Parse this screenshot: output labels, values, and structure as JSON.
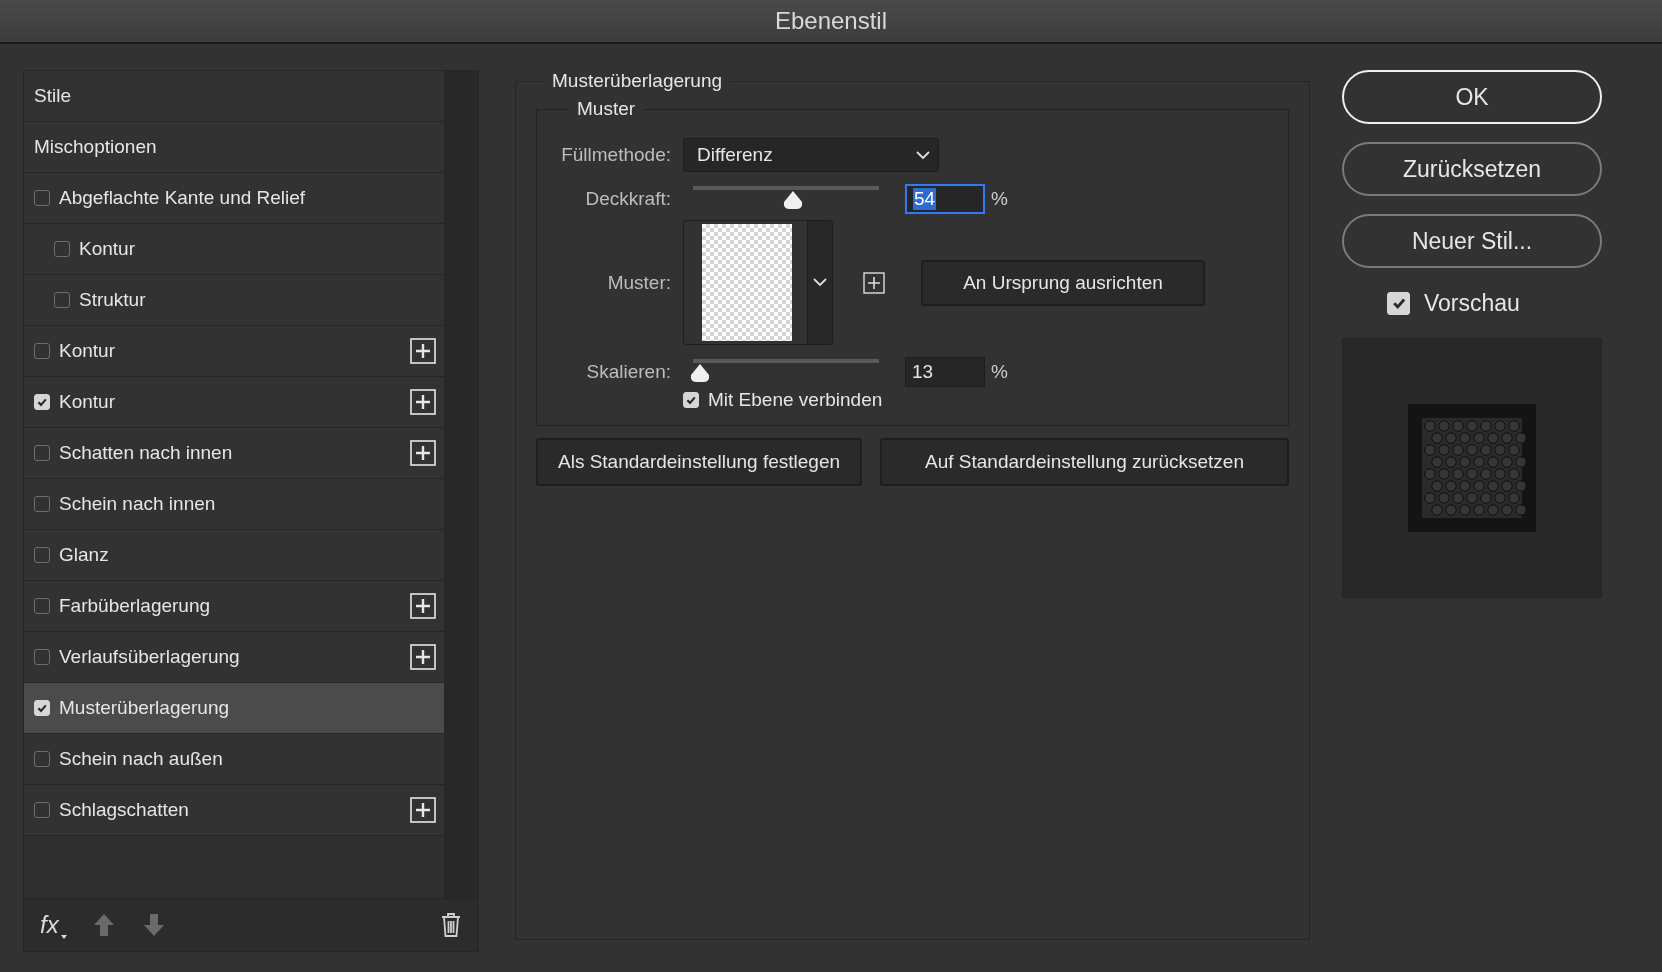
{
  "window": {
    "title": "Ebenenstil"
  },
  "styles_list": [
    {
      "label": "Stile",
      "kind": "header",
      "selected": false
    },
    {
      "label": "Mischoptionen",
      "kind": "header",
      "selected": false
    },
    {
      "label": "Abgeflachte Kante und Relief",
      "kind": "check",
      "checked": false,
      "plus": false,
      "selected": false,
      "children": [
        {
          "label": "Kontur",
          "kind": "check",
          "checked": false,
          "plus": false,
          "selected": false
        },
        {
          "label": "Struktur",
          "kind": "check",
          "checked": false,
          "plus": false,
          "selected": false
        }
      ]
    },
    {
      "label": "Kontur",
      "kind": "check",
      "checked": false,
      "plus": true,
      "selected": false
    },
    {
      "label": "Kontur",
      "kind": "check",
      "checked": true,
      "plus": true,
      "selected": false
    },
    {
      "label": "Schatten nach innen",
      "kind": "check",
      "checked": false,
      "plus": true,
      "selected": false
    },
    {
      "label": "Schein nach innen",
      "kind": "check",
      "checked": false,
      "plus": false,
      "selected": false
    },
    {
      "label": "Glanz",
      "kind": "check",
      "checked": false,
      "plus": false,
      "selected": false
    },
    {
      "label": "Farbüberlagerung",
      "kind": "check",
      "checked": false,
      "plus": true,
      "selected": false
    },
    {
      "label": "Verlaufsüberlagerung",
      "kind": "check",
      "checked": false,
      "plus": true,
      "selected": false
    },
    {
      "label": "Musterüberlagerung",
      "kind": "check",
      "checked": true,
      "plus": false,
      "selected": true
    },
    {
      "label": "Schein nach außen",
      "kind": "check",
      "checked": false,
      "plus": false,
      "selected": false
    },
    {
      "label": "Schlagschatten",
      "kind": "check",
      "checked": false,
      "plus": true,
      "selected": false
    }
  ],
  "footer": {
    "fx": "fx"
  },
  "panel": {
    "title": "Musterüberlagerung",
    "group": "Muster",
    "blend": {
      "label": "Füllmethode:",
      "value": "Differenz"
    },
    "opacity": {
      "label": "Deckkraft:",
      "level": 0.54,
      "value": "54",
      "unit": "%"
    },
    "pattern": {
      "label": "Muster:",
      "snap_button": "An Ursprung ausrichten"
    },
    "scale": {
      "label": "Skalieren:",
      "level": 0.04,
      "value": "13",
      "unit": "%"
    },
    "link": {
      "label": "Mit Ebene verbinden",
      "checked": true
    },
    "buttons": [
      "Als Standardeinstellung festlegen",
      "Auf Standardeinstellung zurücksetzen"
    ]
  },
  "actions": [
    "OK",
    "Zurücksetzen",
    "Neuer Stil..."
  ],
  "preview": {
    "label": "Vorschau",
    "checked": true
  }
}
